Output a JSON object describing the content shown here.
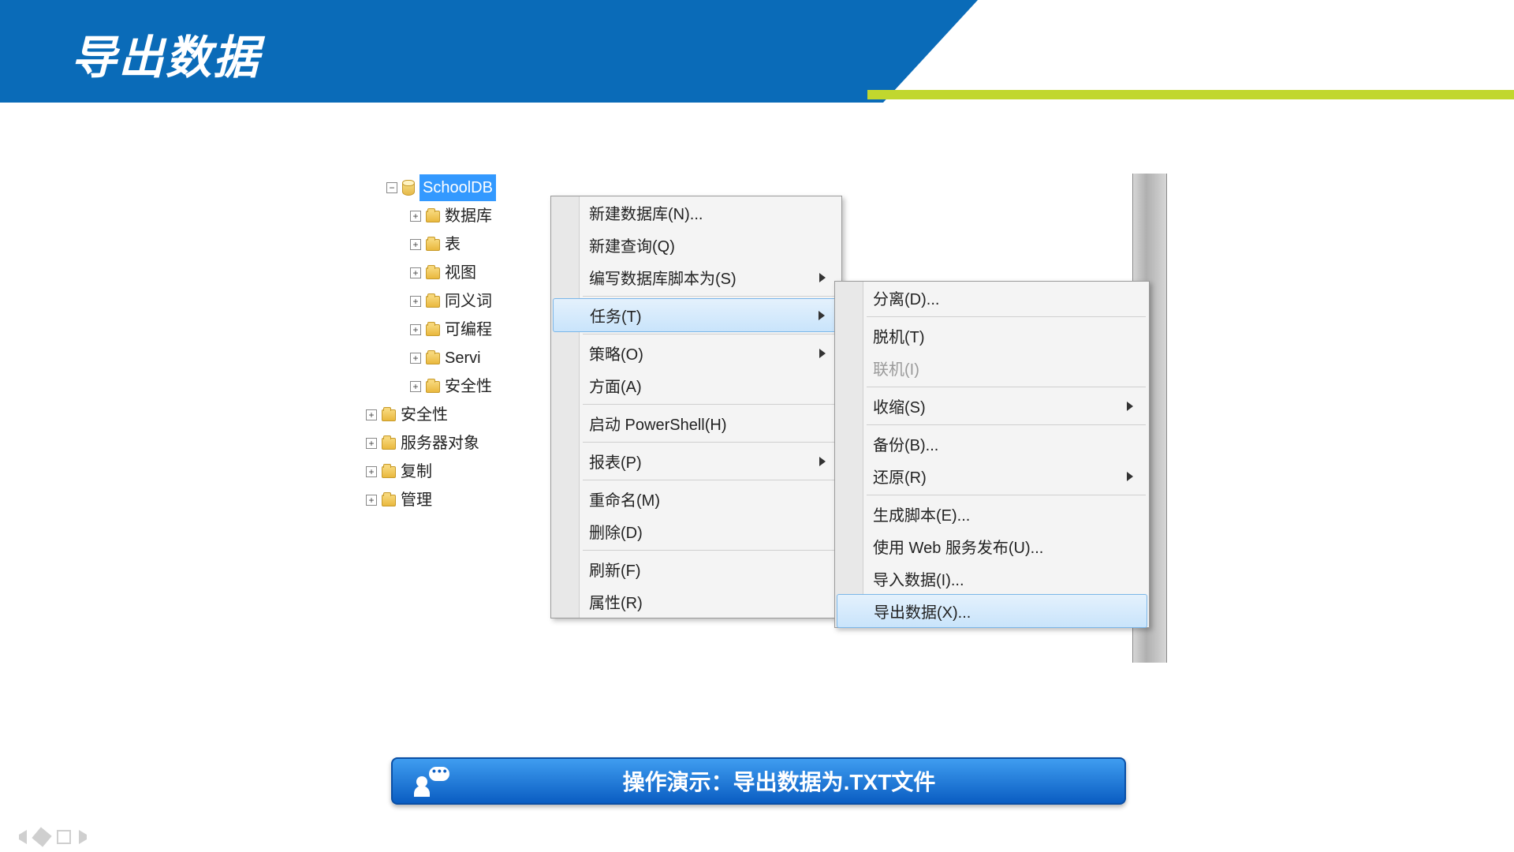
{
  "header": {
    "title": "导出数据"
  },
  "tree": {
    "selected_db": "SchoolDB",
    "db_children": [
      "数据库",
      "表",
      "视图",
      "同义词",
      "可编程性",
      "Service Broker",
      "安全性"
    ],
    "db_children_clipped": [
      "数据库",
      "表",
      "视图",
      "同义词",
      "可编程",
      "Servi",
      "安全性"
    ],
    "root_items": [
      "安全性",
      "服务器对象",
      "复制",
      "管理"
    ]
  },
  "menu1": {
    "items": [
      {
        "label": "新建数据库(N)...",
        "arrow": false
      },
      {
        "label": "新建查询(Q)",
        "arrow": false
      },
      {
        "label": "编写数据库脚本为(S)",
        "arrow": true
      },
      {
        "sep": true
      },
      {
        "label": "任务(T)",
        "arrow": true,
        "highlight": true
      },
      {
        "sep": true
      },
      {
        "label": "策略(O)",
        "arrow": true
      },
      {
        "label": "方面(A)",
        "arrow": false
      },
      {
        "sep": true
      },
      {
        "label": "启动 PowerShell(H)",
        "arrow": false
      },
      {
        "sep": true
      },
      {
        "label": "报表(P)",
        "arrow": true
      },
      {
        "sep": true
      },
      {
        "label": "重命名(M)",
        "arrow": false
      },
      {
        "label": "删除(D)",
        "arrow": false
      },
      {
        "sep": true
      },
      {
        "label": "刷新(F)",
        "arrow": false
      },
      {
        "label": "属性(R)",
        "arrow": false
      }
    ]
  },
  "menu2": {
    "items": [
      {
        "label": "分离(D)...",
        "arrow": false
      },
      {
        "sep": true
      },
      {
        "label": "脱机(T)",
        "arrow": false
      },
      {
        "label": "联机(I)",
        "arrow": false,
        "disabled": true
      },
      {
        "sep": true
      },
      {
        "label": "收缩(S)",
        "arrow": true
      },
      {
        "sep": true
      },
      {
        "label": "备份(B)...",
        "arrow": false
      },
      {
        "label": "还原(R)",
        "arrow": true
      },
      {
        "sep": true
      },
      {
        "label": "生成脚本(E)...",
        "arrow": false
      },
      {
        "label": "使用 Web 服务发布(U)...",
        "arrow": false
      },
      {
        "label": "导入数据(I)...",
        "arrow": false
      },
      {
        "label": "导出数据(X)...",
        "arrow": false,
        "highlight": true
      }
    ]
  },
  "demo": {
    "text": "操作演示：导出数据为.TXT文件"
  }
}
